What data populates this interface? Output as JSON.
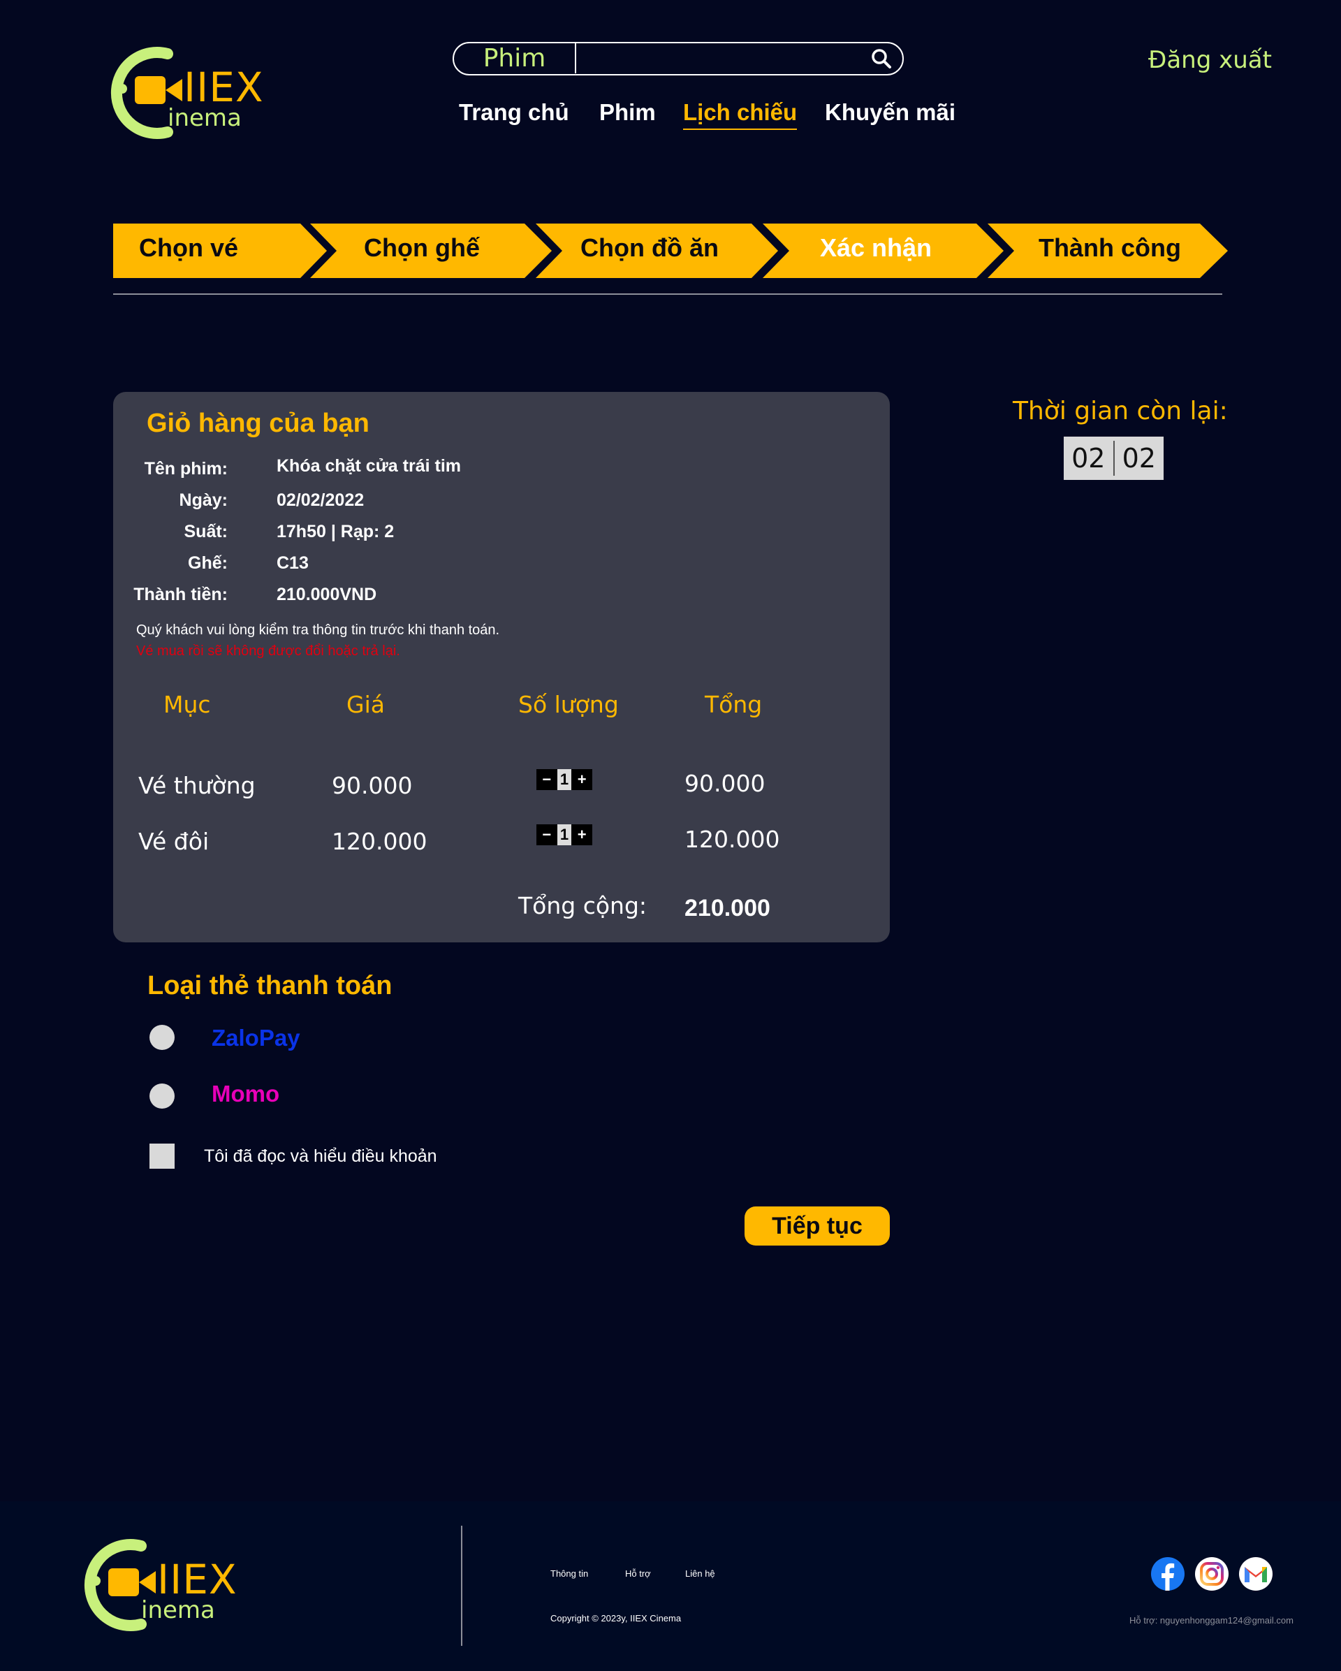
{
  "header": {
    "brand": "IIEX",
    "brand_sub": "inema",
    "search": {
      "category": "Phim",
      "placeholder": ""
    },
    "logout": "Đăng xuất",
    "nav": [
      "Trang chủ",
      "Phim",
      "Lịch chiếu",
      "Khuyến mãi"
    ],
    "active_nav": "Lịch chiếu"
  },
  "steps": [
    "Chọn vé",
    "Chọn ghế",
    "Chọn đồ ăn",
    "Xác nhận",
    "Thành công"
  ],
  "current_step": "Xác nhận",
  "cart": {
    "title": "Giỏ hàng của bạn",
    "info": [
      {
        "label": "Tên phim:",
        "value": "Khóa chặt cửa trái tim"
      },
      {
        "label": "Ngày:",
        "value": "02/02/2022"
      },
      {
        "label": "Suất:",
        "value": "17h50 | Rạp: 2"
      },
      {
        "label": "Ghế:",
        "value": "C13"
      },
      {
        "label": "Thành tiền:",
        "value": "210.000VND"
      }
    ],
    "note": "Quý khách vui lòng kiểm tra thông tin trước khi thanh toán.",
    "warning": "Vé mua rồi sẽ không được đổi hoặc trả lại.",
    "columns": [
      "Mục",
      "Giá",
      "Số lượng",
      "Tổng"
    ],
    "rows": [
      {
        "item": "Vé thường",
        "price": "90.000",
        "qty": "1",
        "total": "90.000"
      },
      {
        "item": "Vé đôi",
        "price": "120.000",
        "qty": "1",
        "total": "120.000"
      }
    ],
    "total_label": "Tổng cộng:",
    "total_value": "210.000"
  },
  "timer": {
    "label": "Thời gian còn lại:",
    "minutes": "02",
    "seconds": "02"
  },
  "payment": {
    "title": "Loại thẻ thanh toán",
    "options": [
      {
        "label": "ZaloPay",
        "color": "#0A33E8"
      },
      {
        "label": "Momo",
        "color": "#E800B8"
      }
    ],
    "terms": "Tôi đã đọc và hiểu điều khoản",
    "continue": "Tiếp tục"
  },
  "footer": {
    "links": [
      "Thông tin",
      "Hỗ trợ",
      "Liên hệ"
    ],
    "copyright": "Copyright © 2023y, IIEX Cinema",
    "support": "Hỗ trợ: nguyenhonggam124@gmail.com",
    "social": [
      "facebook-icon",
      "instagram-icon",
      "gmail-icon"
    ]
  },
  "colors": {
    "accent": "#FFB800",
    "lime": "#C8F07C",
    "bg": "#030720",
    "panel": "#3a3c4a"
  }
}
